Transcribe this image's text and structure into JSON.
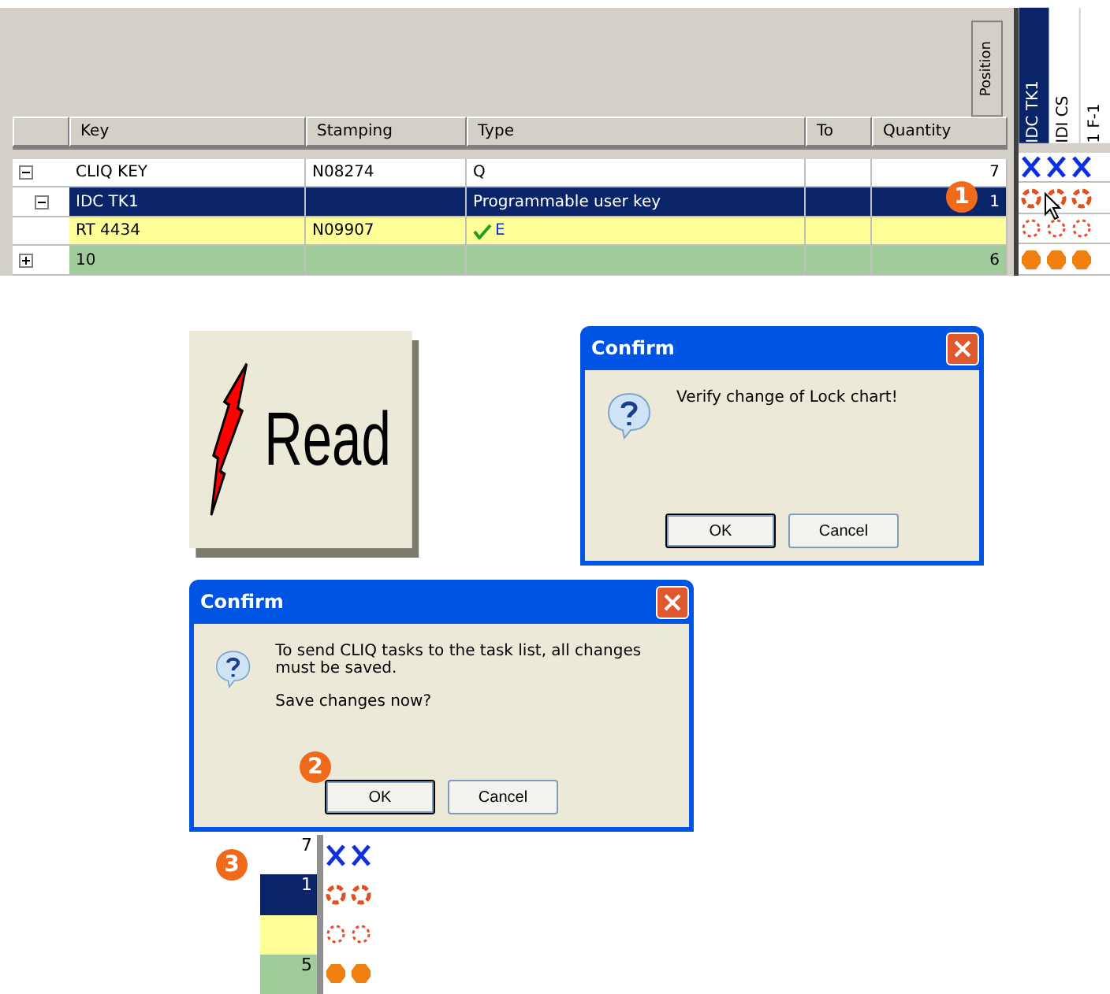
{
  "lock_chart": {
    "position_header": "Position",
    "columns": [
      "Key",
      "Stamping",
      "Type",
      "To",
      "Quantity"
    ],
    "door_headers": [
      {
        "label": "IDC TK1",
        "selected": true
      },
      {
        "label": "IDI CS",
        "selected": false
      },
      {
        "label": "1 F-1",
        "selected": false
      }
    ],
    "rows": [
      {
        "key": "CLIQ KEY",
        "stamping": "N08274",
        "type": "Q",
        "quantity": "7",
        "color": "#ffffff",
        "selected": false,
        "expanded": true,
        "kind": "cross",
        "children": [
          {
            "key": "IDC TK1",
            "type": "Programmable user key",
            "quantity": "1",
            "selected": true,
            "expanded": true,
            "kind": "ring",
            "children": [
              {
                "key": "RT 4434",
                "stamping": "N09907",
                "type": "E",
                "type_checked": true,
                "color": "#ffff99",
                "selected": false,
                "kind": "dashed"
              }
            ]
          }
        ]
      },
      {
        "key": "10",
        "quantity": "6",
        "color": "#a0cc9c",
        "selected": false,
        "expanded": false,
        "kind": "dot"
      }
    ]
  },
  "step_badges": [
    "1",
    "2",
    "3"
  ],
  "read_button": {
    "label": "Read"
  },
  "confirm_lock_chart": {
    "title": "Confirm",
    "message": "Verify change of Lock chart!",
    "buttons": [
      {
        "label": "OK",
        "default": true
      },
      {
        "label": "Cancel",
        "default": false
      }
    ]
  },
  "confirm_save": {
    "title": "Confirm",
    "message": "To send CLIQ tasks to the task list, all changes must be saved.",
    "question": "Save changes now?",
    "buttons": [
      {
        "label": "OK",
        "default": true
      },
      {
        "label": "Cancel",
        "default": false
      }
    ]
  },
  "detail": {
    "rows": [
      {
        "quantity": "7",
        "color": "#ffffff",
        "kind": "cross"
      },
      {
        "quantity": "1",
        "color": "#0a246a",
        "kind": "ring"
      },
      {
        "color": "#ffff99",
        "kind": "dashed"
      },
      {
        "quantity": "5",
        "color": "#a0cc9c",
        "kind": "dot"
      }
    ]
  }
}
